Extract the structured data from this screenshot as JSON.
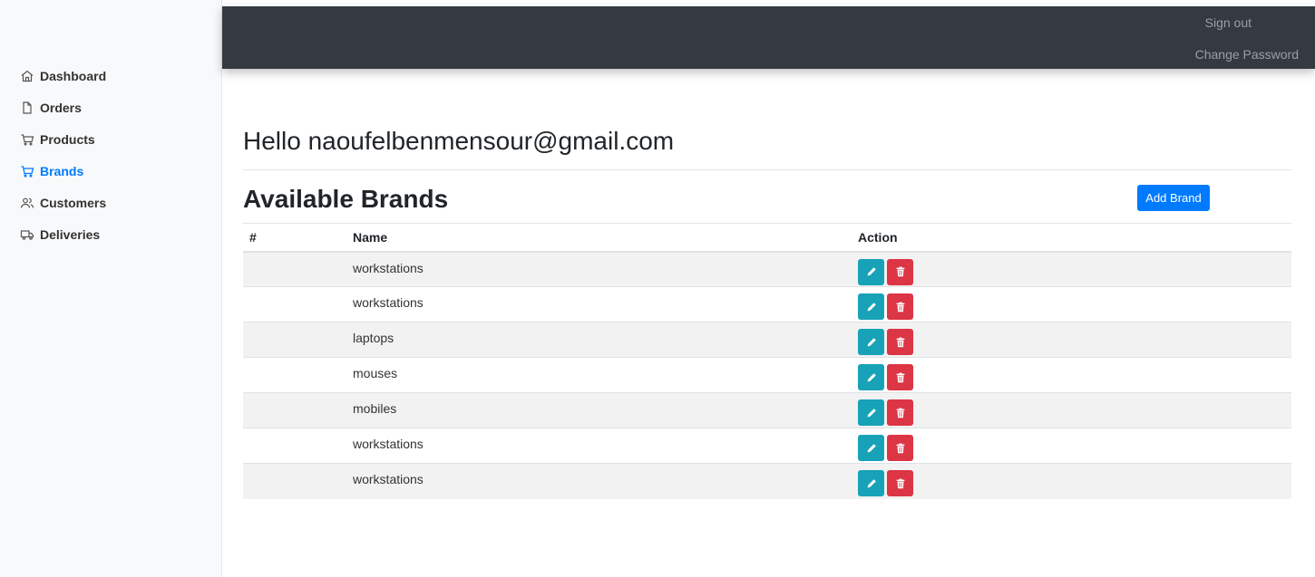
{
  "sidebar": {
    "items": [
      {
        "label": "Dashboard",
        "icon": "home-icon",
        "active": false
      },
      {
        "label": "Orders",
        "icon": "file-icon",
        "active": false
      },
      {
        "label": "Products",
        "icon": "cart-icon",
        "active": false
      },
      {
        "label": "Brands",
        "icon": "cart-icon",
        "active": true
      },
      {
        "label": "Customers",
        "icon": "users-icon",
        "active": false
      },
      {
        "label": "Deliveries",
        "icon": "truck-icon",
        "active": false
      }
    ]
  },
  "topbar": {
    "sign_out": "Sign out",
    "change_password": "Change Password"
  },
  "main": {
    "greeting": "Hello naoufelbenmensour@gmail.com",
    "title": "Available Brands",
    "add_button": "Add Brand",
    "table": {
      "headers": [
        "#",
        "Name",
        "Action"
      ],
      "rows": [
        {
          "num": "",
          "name": "workstations"
        },
        {
          "num": "",
          "name": "workstations"
        },
        {
          "num": "",
          "name": "laptops"
        },
        {
          "num": "",
          "name": "mouses"
        },
        {
          "num": "",
          "name": "mobiles"
        },
        {
          "num": "",
          "name": "workstations"
        },
        {
          "num": "",
          "name": "workstations"
        }
      ]
    }
  },
  "colors": {
    "accent": "#007bff",
    "edit": "#17a2b8",
    "delete": "#dc3545",
    "topbar": "#343a40"
  }
}
